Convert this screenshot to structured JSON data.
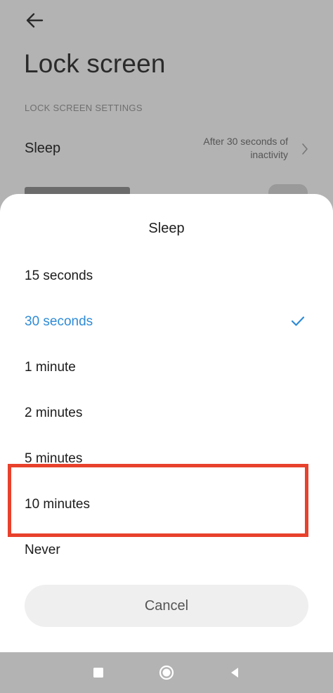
{
  "background": {
    "title": "Lock screen",
    "section_header": "LOCK SCREEN SETTINGS",
    "sleep_row": {
      "label": "Sleep",
      "value_line1": "After 30 seconds of",
      "value_line2": "inactivity"
    }
  },
  "dialog": {
    "title": "Sleep",
    "options": [
      {
        "label": "15 seconds",
        "selected": false
      },
      {
        "label": "30 seconds",
        "selected": true
      },
      {
        "label": "1 minute",
        "selected": false
      },
      {
        "label": "2 minutes",
        "selected": false
      },
      {
        "label": "5 minutes",
        "selected": false
      },
      {
        "label": "10 minutes",
        "selected": false
      },
      {
        "label": "Never",
        "selected": false
      }
    ],
    "cancel_label": "Cancel"
  },
  "colors": {
    "accent": "#2e8bd6",
    "highlight": "#e8412c",
    "scrim": "#b3b3b3"
  },
  "icons": {
    "back": "arrow-left-icon",
    "chevron": "chevron-right-icon",
    "check": "check-icon",
    "nav_recents": "square-icon",
    "nav_home": "circle-icon",
    "nav_back": "triangle-left-icon"
  }
}
